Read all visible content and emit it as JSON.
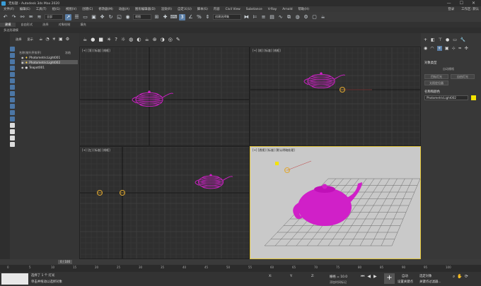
{
  "title": "无标题 - Autodesk 3ds Max 2020",
  "menu": [
    "文件(F)",
    "编辑(E)",
    "工具(T)",
    "组(G)",
    "视图(V)",
    "创建(C)",
    "修改器(M)",
    "动画(A)",
    "图形编辑器(D)",
    "渲染(R)",
    "Civil View",
    "自定义(U)",
    "脚本(S)",
    "内容",
    "Civil View",
    "Substance",
    "V-Ray",
    "Arnold",
    "帮助(H)"
  ],
  "menu_right": {
    "user": "登录",
    "workspace": "工作区: 默认"
  },
  "toolbar": {
    "filter": "全部",
    "view": "视图",
    "selset": "创建选择集"
  },
  "ribbon": {
    "tabs": [
      "建模",
      "自由形式",
      "选择",
      "对象绘制",
      "填充"
    ],
    "sub": "多边形建模"
  },
  "explorer": {
    "tabs": [
      "选择",
      "显示"
    ],
    "header": "名称(按升序排序)",
    "col2": "冻结",
    "items": [
      {
        "name": "PhotometricLight001",
        "selected": false
      },
      {
        "name": "PhotometricLight002",
        "selected": true
      },
      {
        "name": "Teapot001",
        "selected": false
      }
    ]
  },
  "viewports": {
    "top": "[+] [顶] [标准] [线框]",
    "front": "[+] [前] [标准] [线框]",
    "left": "[+] [左] [标准] [线框]",
    "persp": "[+] [透视] [标准] [默认明暗处理]"
  },
  "right_panel": {
    "section1": "对象类型",
    "auto_grid": "自动栅格",
    "btn1": "目标灯光",
    "btn2": "自由灯光",
    "btn3": "太阳定位器",
    "section2": "名称和颜色",
    "name": "PhotometricLight002",
    "swatch": "#f3e300"
  },
  "timeline": {
    "frame": "0 / 100",
    "ticks": [
      "0",
      "5",
      "10",
      "15",
      "20",
      "25",
      "30",
      "35",
      "40",
      "45",
      "50",
      "55",
      "60",
      "65",
      "70",
      "75",
      "80",
      "85",
      "90",
      "95",
      "100"
    ]
  },
  "status": {
    "sel": "选择了 1 个 灯光",
    "hint": "单击并拖动以选择对象",
    "x": "X:",
    "y": "Y:",
    "z": "Z:",
    "grid": "栅格 = 10.0",
    "addkey": "添加时间标记",
    "autokey": "自动",
    "setkey": "设置关键点",
    "selobj": "选定对象",
    "filters": "关键点过滤器...",
    "maxscript": "MAXScript 迷你侦听器"
  },
  "colors": {
    "teapot": "#d020c8",
    "light": "#e0a830",
    "active": "#e3c63a"
  }
}
